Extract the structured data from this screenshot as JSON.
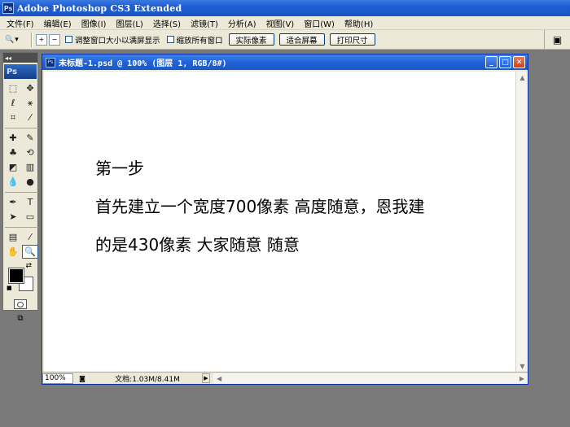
{
  "app": {
    "icon_label": "Ps",
    "title": "Adobe Photoshop CS3 Extended"
  },
  "menu": [
    "文件(F)",
    "编辑(E)",
    "图像(I)",
    "图层(L)",
    "选择(S)",
    "滤镜(T)",
    "分析(A)",
    "视图(V)",
    "窗口(W)",
    "帮助(H)"
  ],
  "options": {
    "resize_windows": "调整窗口大小以满屏显示",
    "zoom_all_windows": "缩放所有窗口",
    "actual_pixels": "实际像素",
    "fit_screen": "适合屏幕",
    "print_size": "打印尺寸"
  },
  "toolbox": {
    "logo": "Ps"
  },
  "document": {
    "title": "未标题-1.psd @ 100% (图层 1, RGB/8#)",
    "canvas_lines": [
      "第一步",
      "首先建立一个宽度700像素 高度随意，恩我建",
      "的是430像素 大家随意 随意"
    ],
    "status": {
      "zoom": "100%",
      "doc_info": "文档:1.03M/8.41M"
    }
  }
}
